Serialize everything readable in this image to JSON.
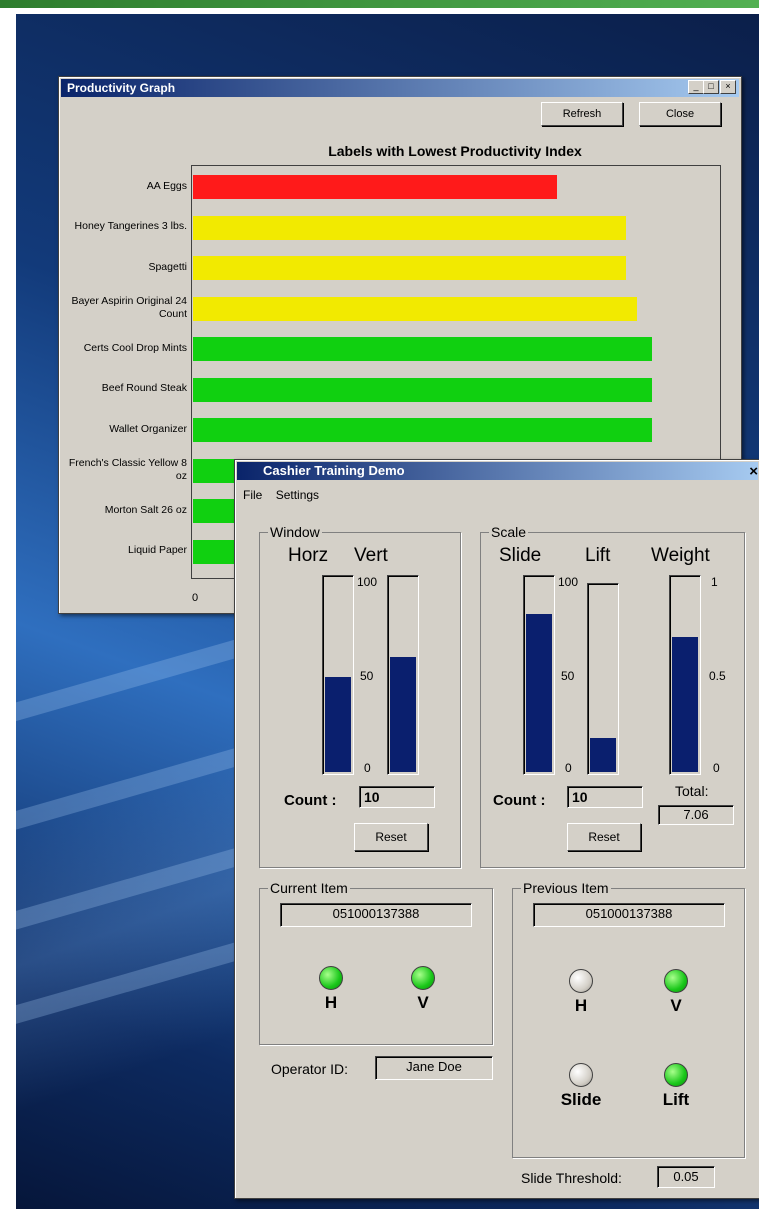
{
  "productivity_window": {
    "title": "Productivity Graph",
    "window_controls": [
      "_",
      "□",
      "×"
    ],
    "refresh_label": "Refresh",
    "close_label": "Close",
    "chart_title": "Labels with Lowest Productivity Index",
    "x_tick_zero": "0"
  },
  "chart_data": {
    "type": "bar",
    "orientation": "horizontal",
    "title": "Labels with Lowest Productivity Index",
    "categories": [
      "AA Eggs",
      "Honey Tangerines 3 lbs.",
      "Spagetti",
      "Bayer Aspirin Original 24 Count",
      "Certs Cool Drop Mints",
      "Beef Round Steak",
      "Wallet Organizer",
      "French's Classic Yellow 8 oz",
      "Morton Salt 26 oz",
      "Liquid Paper"
    ],
    "values": [
      0.69,
      0.82,
      0.82,
      0.84,
      0.87,
      0.87,
      0.87,
      0.88,
      0.88,
      0.88
    ],
    "bar_colors": [
      "#ff1a1a",
      "#f2ea00",
      "#f2ea00",
      "#f2ea00",
      "#10d010",
      "#10d010",
      "#10d010",
      "#10d010",
      "#10d010",
      "#10d010"
    ],
    "xlim": [
      0,
      1
    ]
  },
  "cashier_window": {
    "title": "Cashier Training Demo",
    "close_glyph": "×",
    "menu": [
      "File",
      "Settings"
    ],
    "window_group": {
      "legend": "Window",
      "horz_label": "Horz",
      "vert_label": "Vert",
      "horz_level": 0.5,
      "vert_level": 0.6,
      "ticks": [
        "100",
        "50",
        "0"
      ],
      "count_label": "Count :",
      "count_value": "10",
      "reset_label": "Reset"
    },
    "scale_group": {
      "legend": "Scale",
      "slide_label": "Slide",
      "lift_label": "Lift",
      "weight_label": "Weight",
      "slide_level": 0.82,
      "lift_level": 0.2,
      "weight_level": 0.7,
      "ticks": [
        "100",
        "50",
        "0"
      ],
      "weight_ticks": [
        "1",
        "0.5",
        "0"
      ],
      "count_label": "Count :",
      "count_value": "10",
      "reset_label": "Reset",
      "total_label": "Total:",
      "total_value": "7.06"
    },
    "current_item": {
      "legend": "Current Item",
      "code": "051000137388",
      "h_label": "H",
      "v_label": "V"
    },
    "previous_item": {
      "legend": "Previous Item",
      "code": "051000137388",
      "h_label": "H",
      "v_label": "V",
      "slide_label": "Slide",
      "lift_label": "Lift"
    },
    "operator_label": "Operator ID:",
    "operator_value": "Jane Doe",
    "threshold_label": "Slide Threshold:",
    "threshold_value": "0.05"
  },
  "colors": {
    "window_face": "#d4d0c8",
    "gauge_fill": "#0a1f6e",
    "led_on": "#19c719",
    "title_gradient_start": "#0a246a"
  }
}
